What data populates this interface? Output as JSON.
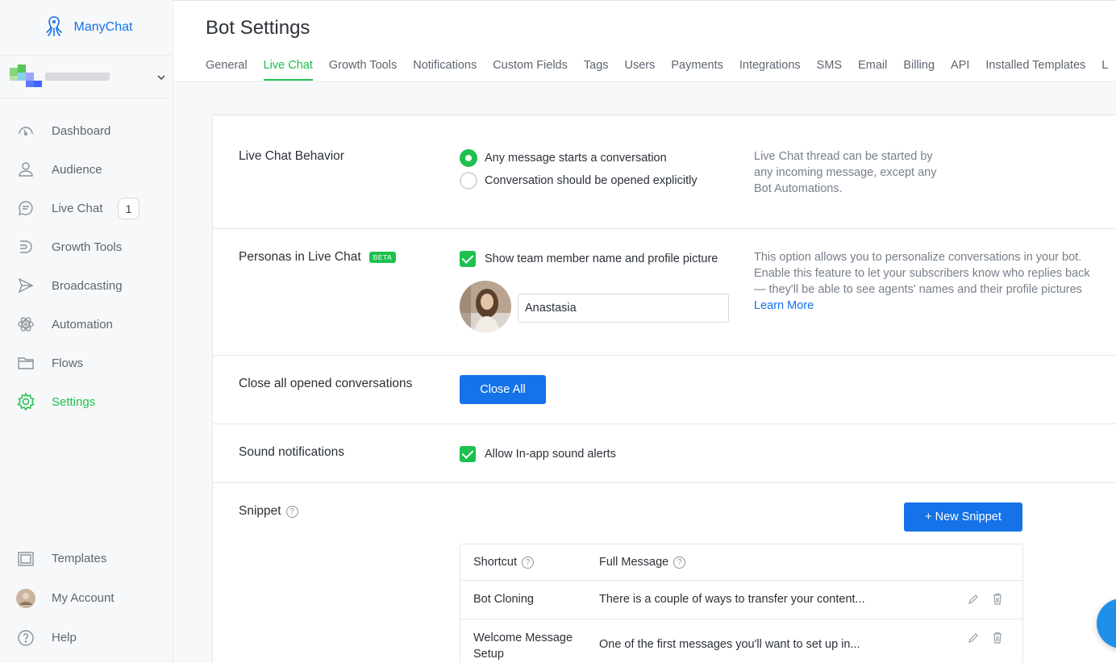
{
  "brand": {
    "name": "ManyChat"
  },
  "sidebar": {
    "items": [
      {
        "label": "Dashboard",
        "icon": "dashboard-icon"
      },
      {
        "label": "Audience",
        "icon": "person-icon"
      },
      {
        "label": "Live Chat",
        "icon": "chat-bubble-icon",
        "badge": "1"
      },
      {
        "label": "Growth Tools",
        "icon": "growth-tools-icon"
      },
      {
        "label": "Broadcasting",
        "icon": "send-icon"
      },
      {
        "label": "Automation",
        "icon": "atom-icon"
      },
      {
        "label": "Flows",
        "icon": "folder-icon"
      },
      {
        "label": "Settings",
        "icon": "gear-icon"
      }
    ],
    "bottom": [
      {
        "label": "Templates",
        "icon": "templates-icon"
      },
      {
        "label": "My Account",
        "icon": "avatar"
      },
      {
        "label": "Help",
        "icon": "help-icon"
      }
    ]
  },
  "header": {
    "title": "Bot Settings",
    "tabs": [
      "General",
      "Live Chat",
      "Growth Tools",
      "Notifications",
      "Custom Fields",
      "Tags",
      "Users",
      "Payments",
      "Integrations",
      "SMS",
      "Email",
      "Billing",
      "API",
      "Installed Templates",
      "L"
    ],
    "active_tab": "Live Chat"
  },
  "behavior": {
    "label": "Live Chat Behavior",
    "options": [
      "Any message starts a conversation",
      "Conversation should be opened explicitly"
    ],
    "selected": "Any message starts a conversation",
    "help": "Live Chat thread can be started by any incoming message, except any Bot Automations."
  },
  "personas": {
    "label": "Personas in Live Chat",
    "badge": "BETA",
    "checkbox_label": "Show team member name and profile picture",
    "checked": true,
    "name_value": "Anastasia",
    "help": "This option allows you to personalize conversations in your bot. Enable this feature to let your subscribers know who replies back — they'll be able to see agents' names and their profile pictures",
    "learn_more": "Learn More"
  },
  "close_all": {
    "label": "Close all opened conversations",
    "button": "Close All"
  },
  "sound": {
    "label": "Sound notifications",
    "checkbox_label": "Allow In-app sound alerts",
    "checked": true
  },
  "snippet": {
    "label": "Snippet",
    "new_button": "+ New Snippet",
    "columns": [
      "Shortcut",
      "Full Message"
    ],
    "rows": [
      {
        "shortcut": "Bot Cloning",
        "message": "There is a couple of ways to transfer your content..."
      },
      {
        "shortcut": "Welcome Message Setup",
        "message": "One of the first messages you'll want to set up in..."
      }
    ]
  },
  "colors": {
    "accent_green": "#1ec04e",
    "primary_blue": "#1572e8"
  }
}
